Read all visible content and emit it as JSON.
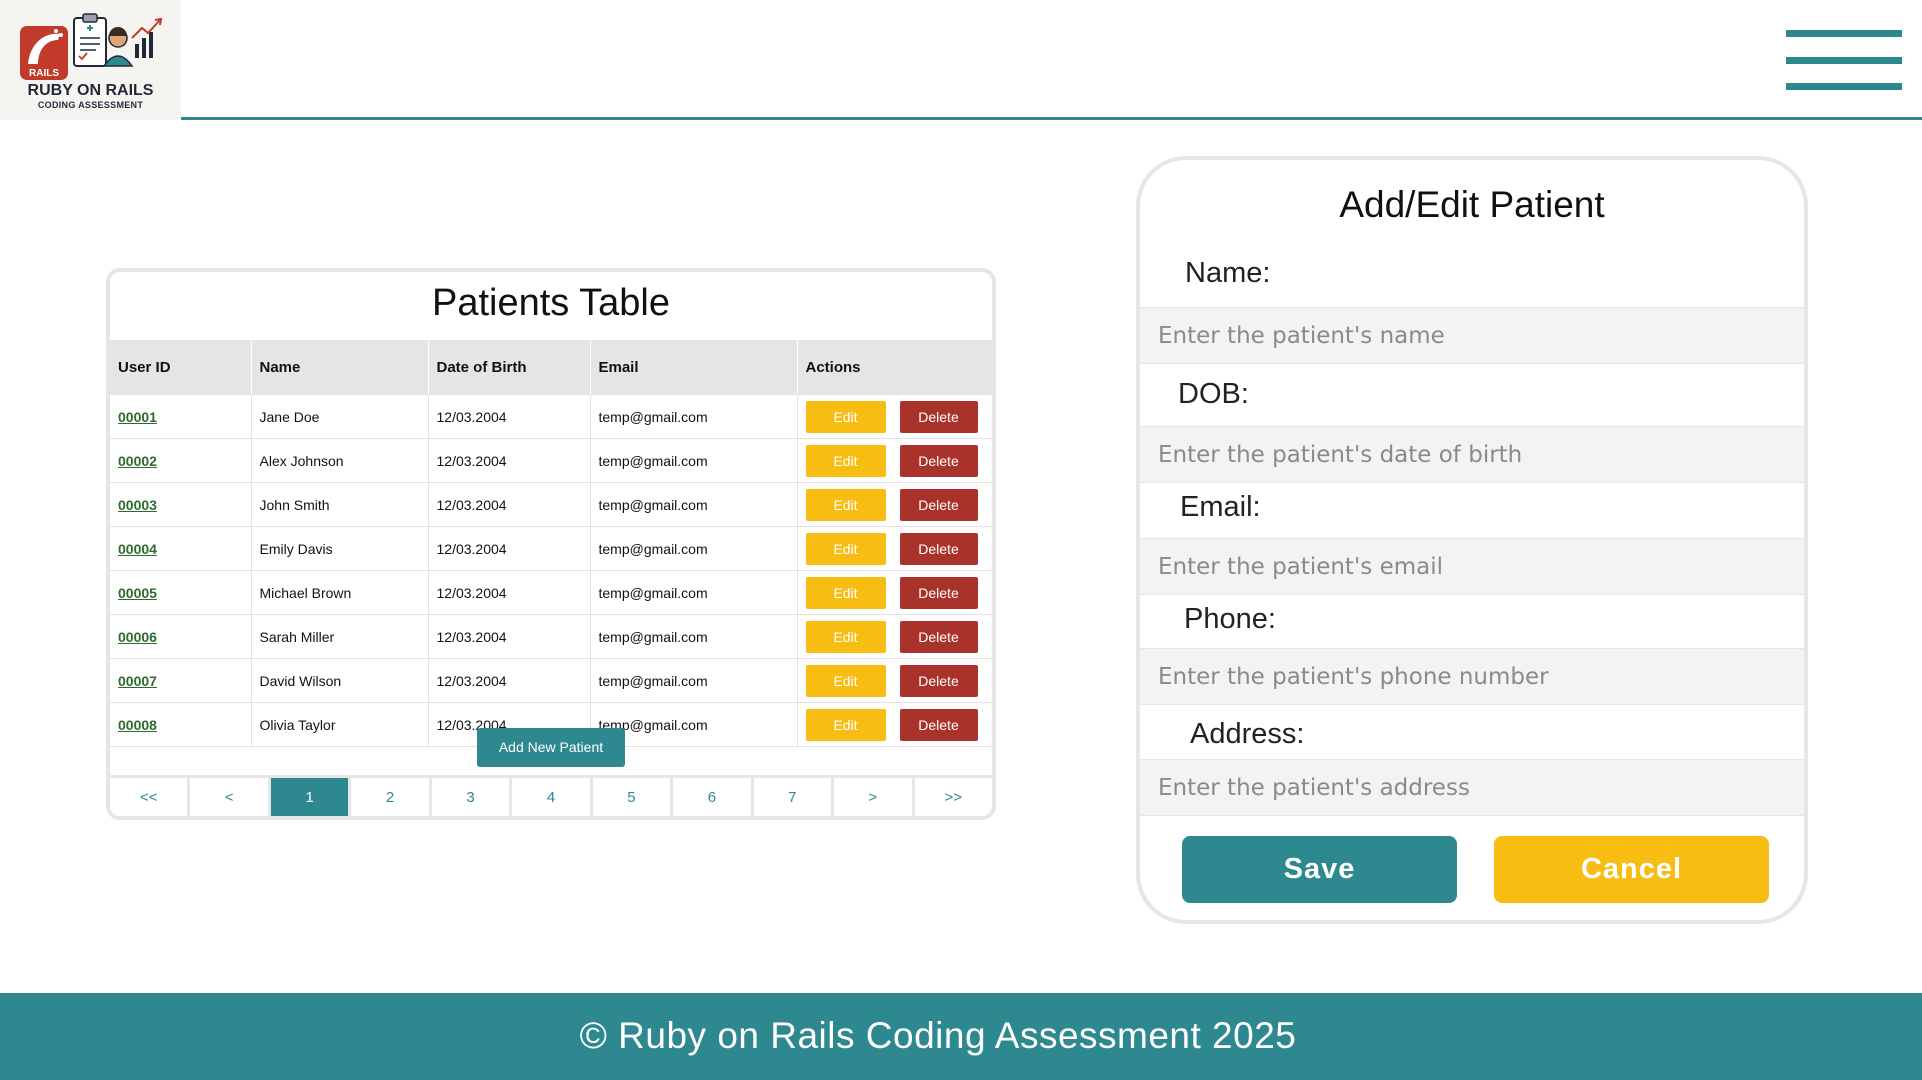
{
  "logo": {
    "line1": "RUBY ON RAILS",
    "line2": "CODING ASSESSMENT",
    "badge": "RAILS"
  },
  "table": {
    "title": "Patients Table",
    "headers": [
      "User ID",
      "Name",
      "Date of Birth",
      "Email",
      "Actions"
    ],
    "rows": [
      {
        "id": "00001",
        "name": "Jane Doe",
        "dob": "12/03.2004",
        "email": "temp@gmail.com"
      },
      {
        "id": "00002",
        "name": "Alex Johnson",
        "dob": "12/03.2004",
        "email": "temp@gmail.com"
      },
      {
        "id": "00003",
        "name": "John Smith",
        "dob": "12/03.2004",
        "email": "temp@gmail.com"
      },
      {
        "id": "00004",
        "name": "Emily Davis",
        "dob": "12/03.2004",
        "email": "temp@gmail.com"
      },
      {
        "id": "00005",
        "name": "Michael Brown",
        "dob": "12/03.2004",
        "email": "temp@gmail.com"
      },
      {
        "id": "00006",
        "name": "Sarah Miller",
        "dob": "12/03.2004",
        "email": "temp@gmail.com"
      },
      {
        "id": "00007",
        "name": "David Wilson",
        "dob": "12/03.2004",
        "email": "temp@gmail.com"
      },
      {
        "id": "00008",
        "name": "Olivia Taylor",
        "dob": "12/03.2004",
        "email": "temp@gmail.com"
      }
    ],
    "edit_label": "Edit",
    "delete_label": "Delete",
    "add_label": "Add New Patient",
    "pagination": [
      "<<",
      "<",
      "1",
      "2",
      "3",
      "4",
      "5",
      "6",
      "7",
      ">",
      ">>"
    ],
    "active_page": "1"
  },
  "form": {
    "title": "Add/Edit Patient",
    "name_label": "Name:",
    "name_placeholder": "Enter the patient's name",
    "dob_label": "DOB:",
    "dob_placeholder": "Enter the patient's date of birth",
    "email_label": "Email:",
    "email_placeholder": "Enter the patient's email",
    "phone_label": "Phone:",
    "phone_placeholder": "Enter the patient's phone number",
    "address_label": "Address:",
    "address_placeholder": "Enter the patient's address",
    "save_label": "Save",
    "cancel_label": "Cancel"
  },
  "footer": {
    "text": "© Ruby on Rails Coding Assessment 2025"
  },
  "colors": {
    "primary": "#2e8890",
    "edit": "#f8bd12",
    "delete": "#a9332b",
    "link": "#2f6b2f"
  }
}
